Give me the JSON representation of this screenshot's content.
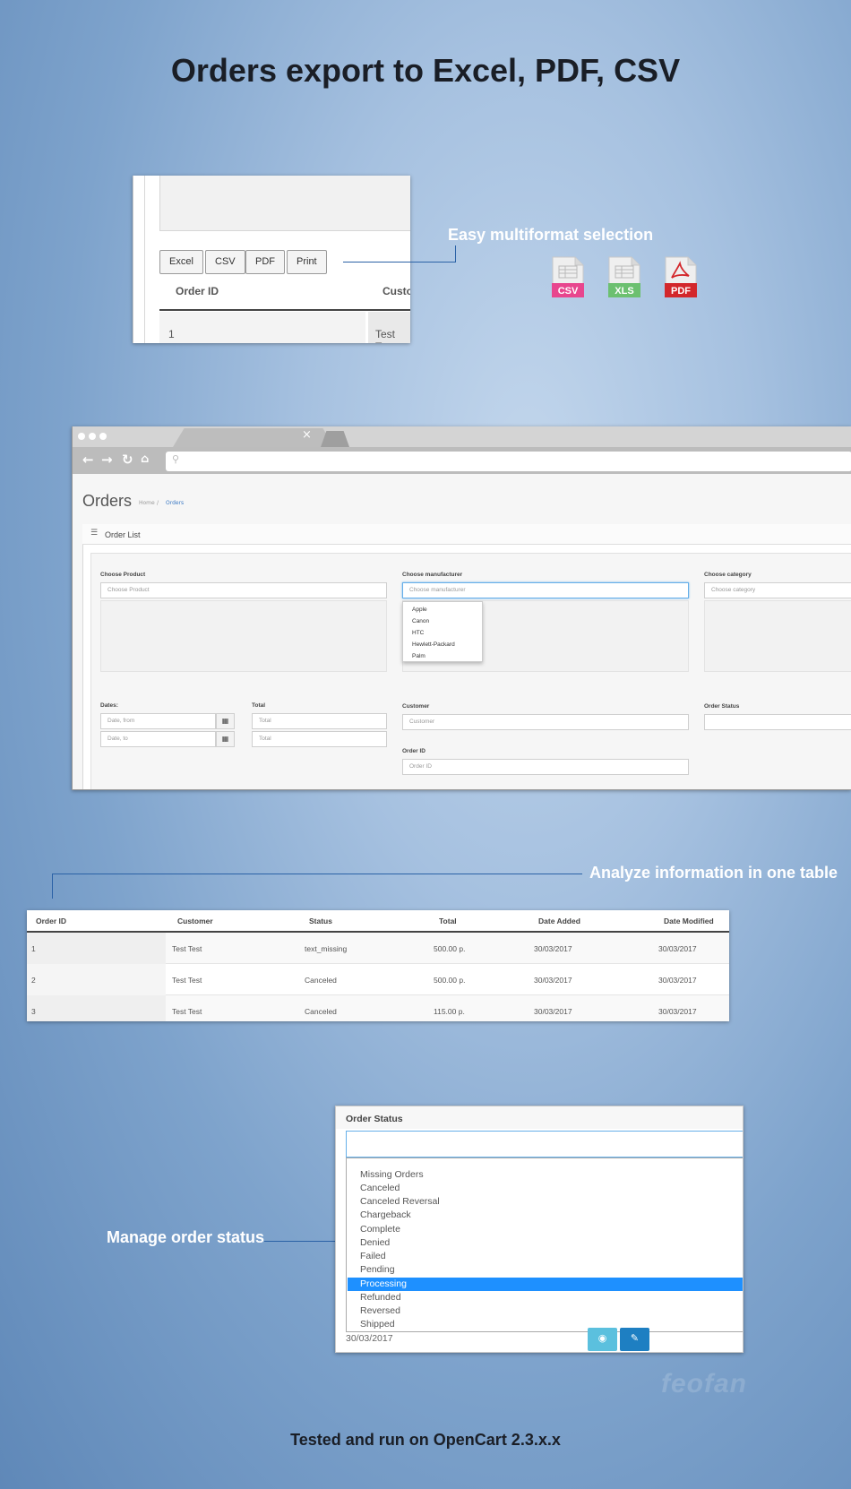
{
  "title": "Orders export to Excel, PDF, CSV",
  "footer": "Tested and run on OpenCart 2.3.x.x",
  "watermark": "feofan",
  "export_panel": {
    "buttons": [
      "Excel",
      "CSV",
      "PDF",
      "Print"
    ],
    "columns": [
      "Order ID",
      "Customer"
    ],
    "first_row": {
      "order_id": "1",
      "customer": "Test Test"
    }
  },
  "callouts": {
    "multiformat": "Easy multiformat selection",
    "analyze": "Analyze information in one table",
    "manage_status": "Manage order status"
  },
  "file_icons": [
    {
      "label": "CSV",
      "color": "#e8468e"
    },
    {
      "label": "XLS",
      "color": "#6cc070"
    },
    {
      "label": "PDF",
      "color": "#d3272b"
    }
  ],
  "browser": {
    "tab_close": "×",
    "page_title": "Orders",
    "breadcrumb": {
      "home": "Home",
      "separator": "/",
      "current": "Orders"
    },
    "panel_title": "Order List",
    "filters": {
      "product": {
        "label": "Choose Product",
        "placeholder": "Choose Product"
      },
      "manufacturer": {
        "label": "Choose manufacturer",
        "placeholder": "Choose manufacturer",
        "options": [
          "Apple",
          "Canon",
          "HTC",
          "Hewlett-Packard",
          "Palm"
        ]
      },
      "category": {
        "label": "Choose category",
        "placeholder": "Choose category"
      },
      "dates": {
        "label": "Dates:",
        "from": "Date, from",
        "to": "Date, to"
      },
      "total": {
        "label": "Total",
        "placeholder": "Total"
      },
      "customer": {
        "label": "Customer",
        "placeholder": "Customer"
      },
      "order_status": {
        "label": "Order Status"
      },
      "order_id": {
        "label": "Order ID",
        "placeholder": "Order ID"
      }
    }
  },
  "orders_table": {
    "columns": [
      "Order ID",
      "Customer",
      "Status",
      "Total",
      "Date Added",
      "Date Modified"
    ],
    "rows": [
      [
        "1",
        "Test Test",
        "text_missing",
        "500.00 p.",
        "30/03/2017",
        "30/03/2017"
      ],
      [
        "2",
        "Test Test",
        "Canceled",
        "500.00 p.",
        "30/03/2017",
        "30/03/2017"
      ],
      [
        "3",
        "Test Test",
        "Canceled",
        "115.00 p.",
        "30/03/2017",
        "30/03/2017"
      ]
    ]
  },
  "status_panel": {
    "title": "Order Status",
    "options": [
      "Missing Orders",
      "Canceled",
      "Canceled Reversal",
      "Chargeback",
      "Complete",
      "Denied",
      "Failed",
      "Pending",
      "Processing",
      "Refunded",
      "Reversed",
      "Shipped"
    ],
    "selected": "Processing",
    "date": "30/03/2017"
  },
  "colors": {
    "accent": "#1e90ff",
    "line": "#2b62a6"
  }
}
